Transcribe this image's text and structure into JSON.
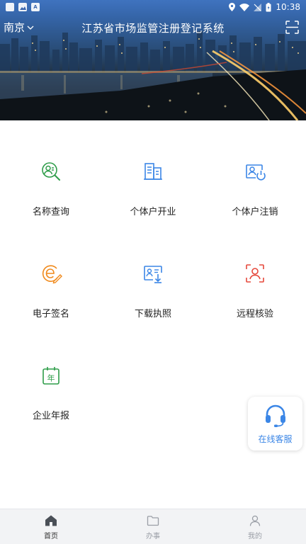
{
  "status_bar": {
    "time": "10:38"
  },
  "header": {
    "city": "南京",
    "title": "江苏省市场监管注册登记系统"
  },
  "services": [
    {
      "label": "名称查询",
      "icon": "name-search-icon",
      "color": "#2f9d4a"
    },
    {
      "label": "个体户开业",
      "icon": "building-icon",
      "color": "#3b86e6"
    },
    {
      "label": "个体户注销",
      "icon": "id-card-power-icon",
      "color": "#3b86e6"
    },
    {
      "label": "电子签名",
      "icon": "e-sign-icon",
      "color": "#f08a1c"
    },
    {
      "label": "下载执照",
      "icon": "license-download-icon",
      "color": "#3b86e6"
    },
    {
      "label": "远程核验",
      "icon": "face-verify-icon",
      "color": "#e5483c"
    },
    {
      "label": "企业年报",
      "icon": "calendar-year-icon",
      "color": "#2f9d4a"
    }
  ],
  "calendar_glyph": "年",
  "support": {
    "label": "在线客服",
    "color": "#3b86e6"
  },
  "tabbar": {
    "items": [
      {
        "label": "首页",
        "icon": "home-icon",
        "active": true
      },
      {
        "label": "办事",
        "icon": "folder-icon",
        "active": false
      },
      {
        "label": "我的",
        "icon": "user-icon",
        "active": false
      }
    ]
  }
}
